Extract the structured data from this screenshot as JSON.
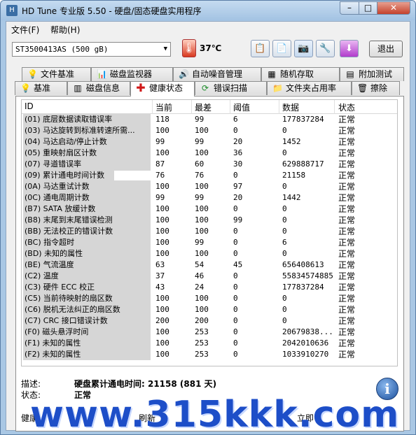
{
  "window": {
    "title": "HD Tune 专业版 5.50 - 硬盘/固态硬盘实用程序"
  },
  "menu": {
    "file": "文件(F)",
    "help": "帮助(H)"
  },
  "toolbar": {
    "drive": "ST3500413AS (500 gB)",
    "temperature": "37℃",
    "exit_label": "退出"
  },
  "tabs_row1": [
    "文件基准",
    "磁盘监视器",
    "自动噪音管理",
    "随机存取",
    "附加测试"
  ],
  "tabs_row2": [
    "基准",
    "磁盘信息",
    "健康状态",
    "错误扫描",
    "文件夹占用率",
    "擦除"
  ],
  "table": {
    "headers": [
      "ID",
      "当前",
      "最差",
      "阈值",
      "数据",
      "状态"
    ],
    "rows": [
      {
        "id": "(01) 底层数据读取错误率",
        "cur": "118",
        "worst": "99",
        "thr": "6",
        "data": "177837284",
        "status": "正常"
      },
      {
        "id": "(03) 马达旋转到标准转速所需...",
        "cur": "100",
        "worst": "100",
        "thr": "0",
        "data": "0",
        "status": "正常"
      },
      {
        "id": "(04) 马达启动/停止计数",
        "cur": "99",
        "worst": "99",
        "thr": "20",
        "data": "1452",
        "status": "正常"
      },
      {
        "id": "(05) 重映射扇区计数",
        "cur": "100",
        "worst": "100",
        "thr": "36",
        "data": "0",
        "status": "正常"
      },
      {
        "id": "(07) 寻道错误率",
        "cur": "87",
        "worst": "60",
        "thr": "30",
        "data": "629888717",
        "status": "正常"
      },
      {
        "id": "(09) 累计通电时间计数",
        "cur": "76",
        "worst": "76",
        "thr": "0",
        "data": "21158",
        "status": "正常"
      },
      {
        "id": "(0A) 马达重试计数",
        "cur": "100",
        "worst": "100",
        "thr": "97",
        "data": "0",
        "status": "正常"
      },
      {
        "id": "(0C) 通电周期计数",
        "cur": "99",
        "worst": "99",
        "thr": "20",
        "data": "1442",
        "status": "正常"
      },
      {
        "id": "(B7) SATA 放缓计数",
        "cur": "100",
        "worst": "100",
        "thr": "0",
        "data": "0",
        "status": "正常"
      },
      {
        "id": "(B8) 末尾到末尾错误检测",
        "cur": "100",
        "worst": "100",
        "thr": "99",
        "data": "0",
        "status": "正常"
      },
      {
        "id": "(BB) 无法校正的错误计数",
        "cur": "100",
        "worst": "100",
        "thr": "0",
        "data": "0",
        "status": "正常"
      },
      {
        "id": "(BC) 指令超时",
        "cur": "100",
        "worst": "99",
        "thr": "0",
        "data": "6",
        "status": "正常"
      },
      {
        "id": "(BD) 未知的属性",
        "cur": "100",
        "worst": "100",
        "thr": "0",
        "data": "0",
        "status": "正常"
      },
      {
        "id": "(BE) 气流温度",
        "cur": "63",
        "worst": "54",
        "thr": "45",
        "data": "656408613",
        "status": "正常"
      },
      {
        "id": "(C2) 温度",
        "cur": "37",
        "worst": "46",
        "thr": "0",
        "data": "55834574885",
        "status": "正常"
      },
      {
        "id": "(C3) 硬件 ECC 校正",
        "cur": "43",
        "worst": "24",
        "thr": "0",
        "data": "177837284",
        "status": "正常"
      },
      {
        "id": "(C5) 当前待映射的扇区数",
        "cur": "100",
        "worst": "100",
        "thr": "0",
        "data": "0",
        "status": "正常"
      },
      {
        "id": "(C6) 脱机无法纠正的扇区数",
        "cur": "100",
        "worst": "100",
        "thr": "0",
        "data": "0",
        "status": "正常"
      },
      {
        "id": "(C7) CRC 接口错误计数",
        "cur": "200",
        "worst": "200",
        "thr": "0",
        "data": "0",
        "status": "正常"
      },
      {
        "id": "(F0) 磁头悬浮时间",
        "cur": "100",
        "worst": "253",
        "thr": "0",
        "data": "20679838...",
        "status": "正常"
      },
      {
        "id": "(F1) 未知的属性",
        "cur": "100",
        "worst": "253",
        "thr": "0",
        "data": "2042010636",
        "status": "正常"
      },
      {
        "id": "(F2) 未知的属性",
        "cur": "100",
        "worst": "253",
        "thr": "0",
        "data": "1033910270",
        "status": "正常"
      }
    ]
  },
  "details": {
    "desc_label": "描述:",
    "desc_value": "硬盘累计通电时间: 21158 (881 天)",
    "status_label": "状态:",
    "status_value": "正常"
  },
  "bottom": {
    "left": "健康",
    "middle": "刷新",
    "right": "立即"
  },
  "watermark": "www.315kkk.com"
}
